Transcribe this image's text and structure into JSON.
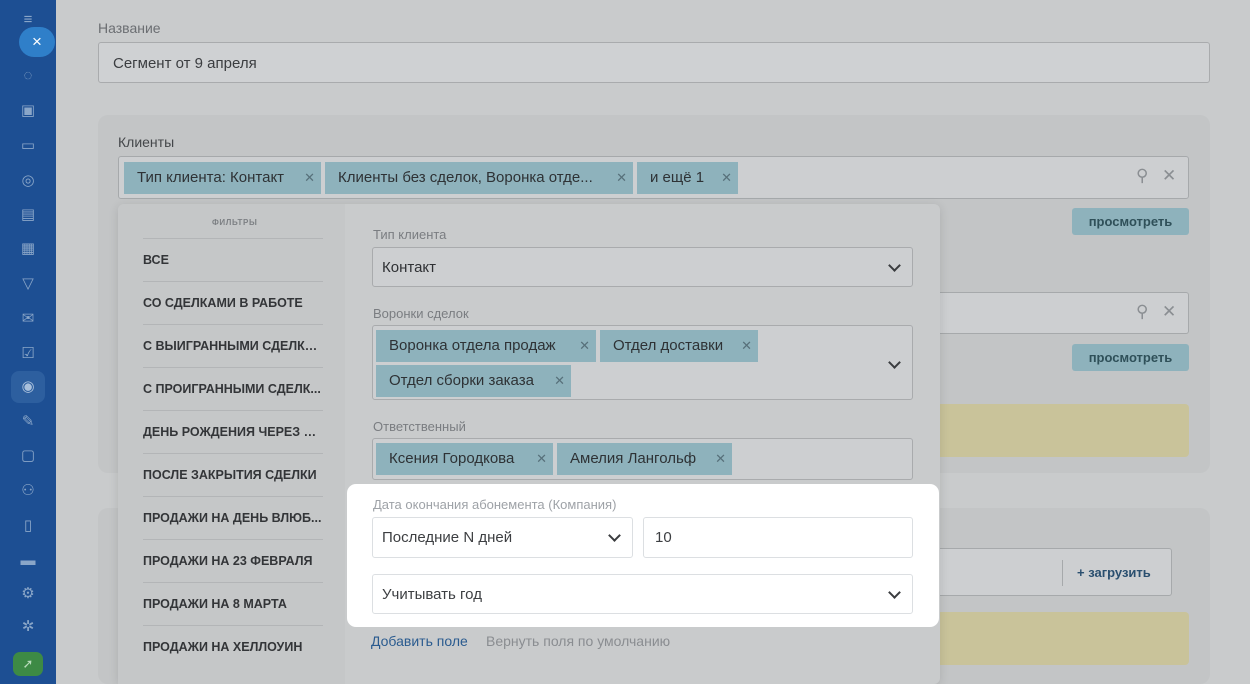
{
  "nav": {
    "close_icon": "×",
    "icons": [
      "chat-icon",
      "tasks-icon",
      "messages-icon",
      "database-icon",
      "document-icon",
      "calendar-icon",
      "funnel-icon",
      "mail-icon",
      "checkbox-icon",
      "target-icon",
      "pencil-icon",
      "ticket-icon",
      "users-icon",
      "file-icon",
      "card-icon",
      "gamepad-icon",
      "settings-icon",
      "rocket-icon"
    ]
  },
  "form": {
    "name_label": "Название",
    "name_value": "Сегмент от 9 апреля",
    "clients_label": "Клиенты",
    "client_chips": [
      {
        "label": "Тип клиента: Контакт"
      },
      {
        "label": "Клиенты без сделок, Воронка отде..."
      },
      {
        "label": "и ещё 1"
      }
    ],
    "view_button": "просмотреть",
    "view_button_2": "просмотреть",
    "upload_button": "+ загрузить"
  },
  "filters": {
    "heading": "ФИЛЬТРЫ",
    "items": [
      "ВСЕ",
      "СО СДЕЛКАМИ В РАБОТЕ",
      "С ВЫИГРАННЫМИ СДЕЛКА...",
      "С ПРОИГРАННЫМИ СДЕЛК...",
      "ДЕНЬ РОЖДЕНИЯ ЧЕРЕЗ 5 ...",
      "ПОСЛЕ ЗАКРЫТИЯ СДЕЛКИ",
      "ПРОДАЖИ НА ДЕНЬ ВЛЮБ...",
      "ПРОДАЖИ НА 23 ФЕВРАЛЯ",
      "ПРОДАЖИ НА 8 МАРТА",
      "ПРОДАЖИ НА ХЕЛЛОУИН"
    ]
  },
  "fields": {
    "client_type_label": "Тип клиента",
    "client_type_value": "Контакт",
    "funnels_label": "Воронки сделок",
    "funnels": [
      "Воронка отдела продаж",
      "Отдел доставки",
      "Отдел сборки заказа"
    ],
    "responsible_label": "Ответственный",
    "responsible": [
      "Ксения Городкова",
      "Амелия Лангольф"
    ],
    "subscription_label": "Дата окончания абонемента (Компания)",
    "period_value": "Последние N дней",
    "days_value": "10",
    "year_value": "Учитывать год",
    "add_field": "Добавить поле",
    "reset_fields": "Вернуть поля по умолчанию"
  }
}
